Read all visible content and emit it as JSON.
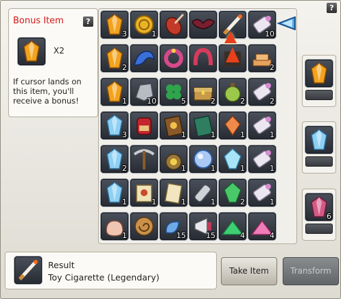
{
  "window": {
    "help_icon": "?"
  },
  "bonus": {
    "title": "Bonus Item",
    "help_icon": "?",
    "item_icon": "orange-crystal-icon",
    "multiplier": "X2",
    "description": "If cursor lands on this item, you'll receive a bonus!"
  },
  "grid": {
    "rows": [
      [
        {
          "icon": "orange-crystal-icon",
          "qty": "3"
        },
        {
          "icon": "gold-coin-icon",
          "qty": "1"
        },
        {
          "icon": "violin-icon",
          "qty": ""
        },
        {
          "icon": "bat-wings-icon",
          "qty": ""
        },
        {
          "icon": "toy-cigarette-icon",
          "qty": "",
          "selected": true
        },
        {
          "icon": "scroll-icon",
          "qty": "10"
        }
      ],
      [
        {
          "icon": "orange-crystal-icon",
          "qty": "2"
        },
        {
          "icon": "blue-dragon-icon",
          "qty": ""
        },
        {
          "icon": "flower-wreath-icon",
          "qty": ""
        },
        {
          "icon": "horseshoe-icon",
          "qty": ""
        },
        {
          "icon": "red-cone-icon",
          "qty": ""
        },
        {
          "icon": "gold-bars-icon",
          "qty": "2"
        }
      ],
      [
        {
          "icon": "orange-crystal-icon",
          "qty": "1"
        },
        {
          "icon": "silver-ore-icon",
          "qty": "10"
        },
        {
          "icon": "clover-icon",
          "qty": "5"
        },
        {
          "icon": "treasure-chest-icon",
          "qty": "2"
        },
        {
          "icon": "potion-bag-icon",
          "qty": "2"
        },
        {
          "icon": "scroll-icon",
          "qty": "2"
        }
      ],
      [
        {
          "icon": "blue-crystal-icon",
          "qty": "3"
        },
        {
          "icon": "red-backpack-icon",
          "qty": ""
        },
        {
          "icon": "skill-book-icon",
          "qty": "1"
        },
        {
          "icon": "green-book-icon",
          "qty": "1"
        },
        {
          "icon": "orange-gem-icon",
          "qty": "1"
        },
        {
          "icon": "scroll-icon",
          "qty": "1"
        }
      ],
      [
        {
          "icon": "blue-crystal-icon",
          "qty": "2"
        },
        {
          "icon": "pickaxe-icon",
          "qty": ""
        },
        {
          "icon": "money-bag-icon",
          "qty": "1"
        },
        {
          "icon": "blue-orb-icon",
          "qty": "1"
        },
        {
          "icon": "blue-gem-icon",
          "qty": "1"
        },
        {
          "icon": "scroll-icon",
          "qty": "1"
        }
      ],
      [
        {
          "icon": "blue-crystal-icon",
          "qty": "1"
        },
        {
          "icon": "map-scroll-icon",
          "qty": "1"
        },
        {
          "icon": "parchment-icon",
          "qty": "1"
        },
        {
          "icon": "bottle-icon",
          "qty": "1"
        },
        {
          "icon": "green-gem-icon",
          "qty": "2"
        },
        {
          "icon": "scroll-icon",
          "qty": "1"
        }
      ],
      [
        {
          "icon": "pink-pouch-icon",
          "qty": "1"
        },
        {
          "icon": "spiral-shell-icon",
          "qty": ""
        },
        {
          "icon": "blue-fish-icon",
          "qty": "15"
        },
        {
          "icon": "megaphone-icon",
          "qty": "15"
        },
        {
          "icon": "green-powder-icon",
          "qty": "4"
        },
        {
          "icon": "pink-powder-icon",
          "qty": "4"
        }
      ]
    ]
  },
  "rewards": [
    {
      "icon": "orange-crystal-icon",
      "qty": ""
    },
    {
      "icon": "blue-crystal-icon",
      "qty": ""
    },
    {
      "icon": "pink-crystal-icon",
      "qty": "6"
    }
  ],
  "result": {
    "label": "Result",
    "value": "Toy Cigarette (Legendary)",
    "icon": "toy-cigarette-icon"
  },
  "buttons": {
    "take": "Take Item",
    "transform": "Transform"
  },
  "colors": {
    "bonus_title": "#d11919",
    "slot_bg": "#2e333b"
  }
}
